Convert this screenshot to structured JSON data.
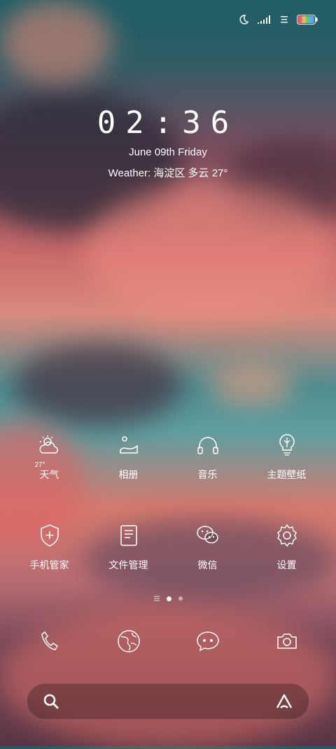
{
  "clock": {
    "time": "02:36",
    "date": "June 09th Friday",
    "weather": "Weather: 海淀区 多云 27°"
  },
  "apps": [
    {
      "label": "天气",
      "icon": "weather-icon",
      "sub": "27°"
    },
    {
      "label": "相册",
      "icon": "gallery-icon"
    },
    {
      "label": "音乐",
      "icon": "headphones-icon"
    },
    {
      "label": "主题壁纸",
      "icon": "lightbulb-icon"
    },
    {
      "label": "手机管家",
      "icon": "shield-icon"
    },
    {
      "label": "文件管理",
      "icon": "file-icon"
    },
    {
      "label": "微信",
      "icon": "wechat-icon"
    },
    {
      "label": "设置",
      "icon": "gear-icon"
    }
  ],
  "dock": [
    {
      "icon": "phone-icon"
    },
    {
      "icon": "browser-icon"
    },
    {
      "icon": "message-icon"
    },
    {
      "icon": "camera-icon"
    }
  ],
  "status": {
    "battery_colors": [
      "#ff5a6a",
      "#ffb24a",
      "#5ad06a",
      "#5aa8ff"
    ]
  },
  "pages": {
    "count": 3,
    "active": 1
  }
}
